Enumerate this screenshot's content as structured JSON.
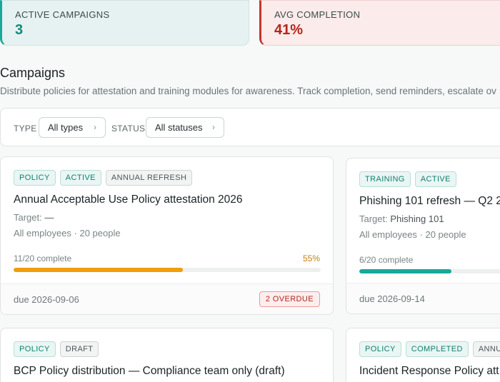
{
  "stats": {
    "active_campaigns": {
      "label": "ACTIVE CAMPAIGNS",
      "value": "3"
    },
    "avg_completion": {
      "label": "AVG COMPLETION",
      "value": "41%"
    }
  },
  "section": {
    "title": "Campaigns",
    "description": "Distribute policies for attestation and training modules for awareness. Track completion, send reminders, escalate ov"
  },
  "filters": {
    "type_label": "TYPE",
    "type_value": "All types",
    "status_label": "STATUS",
    "status_value": "All statuses"
  },
  "cards": [
    {
      "tags": [
        "POLICY",
        "ACTIVE",
        "ANNUAL REFRESH"
      ],
      "title": "Annual Acceptable Use Policy attestation 2026",
      "target_label": "Target:",
      "target_value": "—",
      "audience": "All employees · 20 people",
      "progress_text": "11/20 complete",
      "progress_pct": "55%",
      "progress_fraction": 0.55,
      "bar_color": "#f09d0b",
      "due": "due 2026-09-06",
      "overdue": "2 OVERDUE"
    },
    {
      "tags": [
        "TRAINING",
        "ACTIVE"
      ],
      "title": "Phishing 101 refresh — Q2 2",
      "target_label": "Target:",
      "target_value": "Phishing 101",
      "audience": "All employees · 20 people",
      "progress_text": "6/20 complete",
      "progress_fraction": 0.3,
      "bar_color": "#17a999",
      "due": "due 2026-09-14"
    },
    {
      "tags": [
        "POLICY",
        "DRAFT"
      ],
      "title": "BCP Policy distribution — Compliance team only (draft)"
    },
    {
      "tags": [
        "POLICY",
        "COMPLETED",
        "ANNUAL"
      ],
      "title": "Incident Response Policy att"
    }
  ],
  "colors": {
    "accent_teal": "#17a999",
    "accent_red": "#c0362f",
    "warning_orange": "#f09d0b"
  }
}
